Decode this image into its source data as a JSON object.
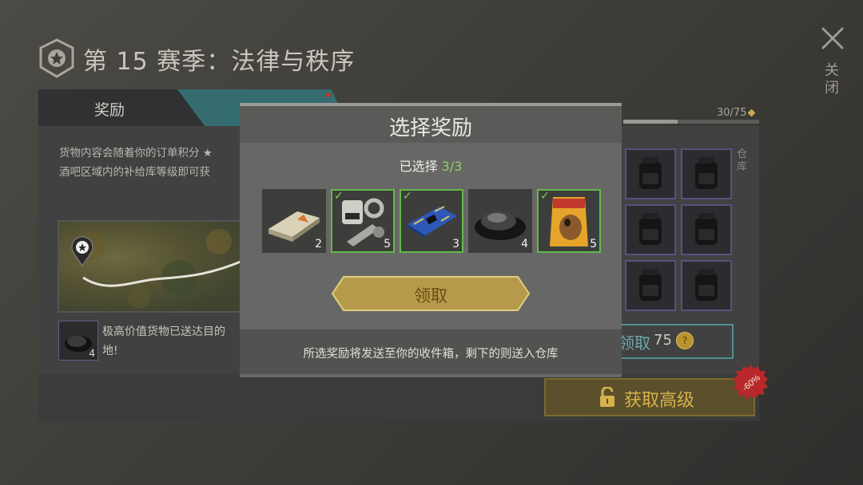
{
  "header": {
    "season_title": "第 15 赛季：法律与秩序",
    "close_label": "关闭"
  },
  "tabs": [
    {
      "label": "奖励"
    },
    {
      "label": ""
    }
  ],
  "progress": {
    "text": "30/75",
    "value": 0.4
  },
  "panel": {
    "description": "货物内容会随着你的订单积分 ★\n酒吧区域内的补给库等级即可获",
    "delivery_count": "4",
    "delivery_text": "极高价值货物已送达目的\n地!",
    "warehouse_label": "仓库",
    "claim_label": "领取",
    "claim_cost": "75",
    "coin_glyph": "?",
    "premium_label": "获取高级",
    "discount": "-60%"
  },
  "modal": {
    "title": "选择奖励",
    "selected_prefix": "已选择 ",
    "selected_value": "3/3",
    "items": [
      {
        "name": "ration-bar",
        "count": "2",
        "selected": false
      },
      {
        "name": "mechanical-parts",
        "count": "5",
        "selected": true
      },
      {
        "name": "circuit-board",
        "count": "3",
        "selected": true
      },
      {
        "name": "gravel-pile",
        "count": "4",
        "selected": false
      },
      {
        "name": "dog-food-bag",
        "count": "5",
        "selected": true
      }
    ],
    "claim_label": "领取",
    "footer_text": "所选奖励将发送至你的收件箱，剩下的则送入仓库"
  },
  "colors": {
    "accent_green": "#8fd066",
    "gold": "#d6b24a",
    "teal": "#356c70"
  }
}
